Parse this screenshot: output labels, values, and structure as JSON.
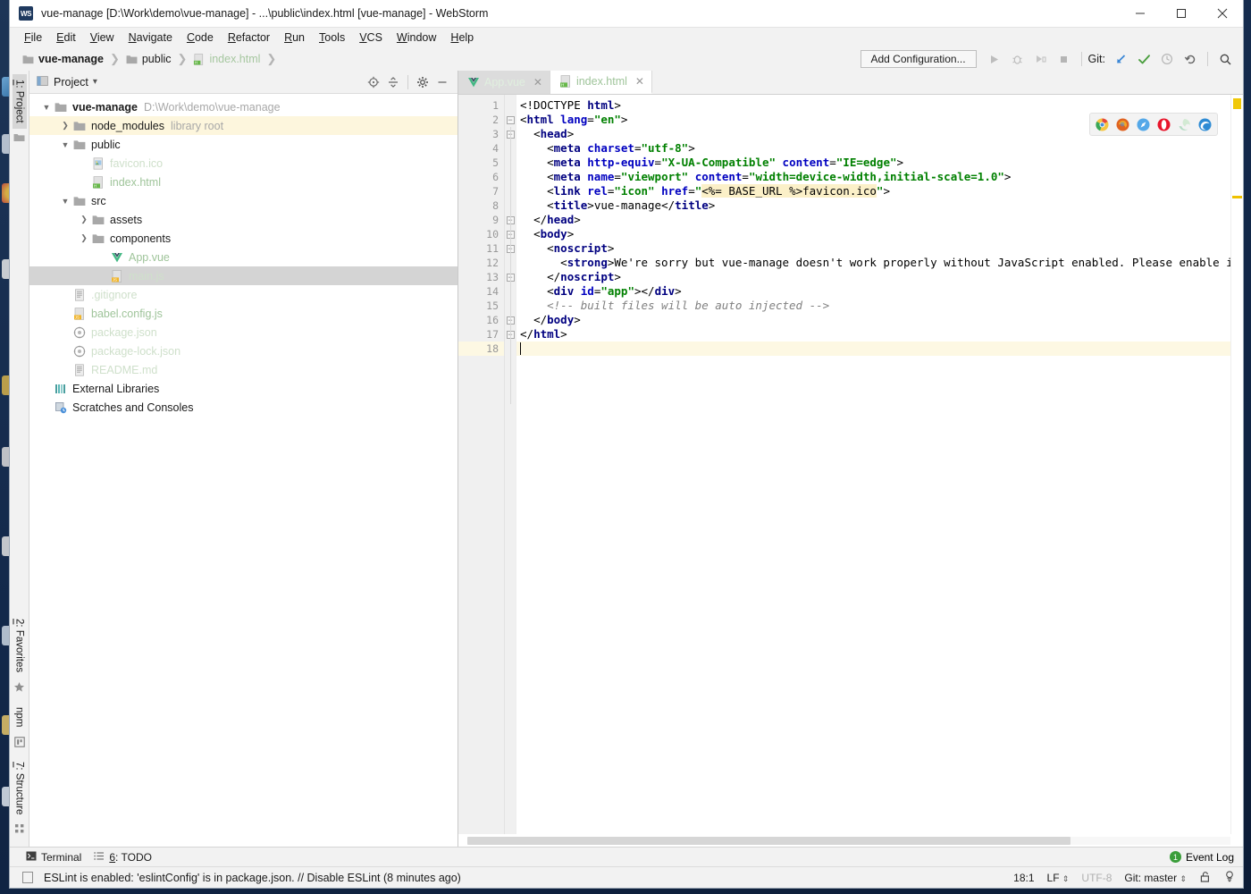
{
  "window": {
    "title": "vue-manage [D:\\Work\\demo\\vue-manage] - ...\\public\\index.html [vue-manage] - WebStorm",
    "logo_text": "WS",
    "minimize": "—",
    "maximize": "▢",
    "close": "✕"
  },
  "menu": [
    "File",
    "Edit",
    "View",
    "Navigate",
    "Code",
    "Refactor",
    "Run",
    "Tools",
    "VCS",
    "Window",
    "Help"
  ],
  "breadcrumb": [
    {
      "label": "vue-manage",
      "style": "bold",
      "icon": "folder-icon"
    },
    {
      "label": "public",
      "style": "normal",
      "icon": "folder-icon"
    },
    {
      "label": "index.html",
      "style": "green",
      "icon": "html-file-icon"
    }
  ],
  "toolbar": {
    "add_configuration": "Add Configuration...",
    "run_icon": "run-icon",
    "debug_icon": "debug-icon",
    "coverage_icon": "coverage-icon",
    "stop_icon": "stop-icon",
    "git_label": "Git:",
    "update_icon": "vcs-update-icon",
    "commit_icon": "vcs-commit-icon",
    "history_icon": "vcs-history-icon",
    "rollback_icon": "vcs-rollback-icon",
    "search_icon": "search-everywhere-icon"
  },
  "left_strip": {
    "top": [
      {
        "label": "1: Project",
        "active": true
      }
    ],
    "bottom": [
      {
        "label": "2: Favorites"
      },
      {
        "label": "npm"
      },
      {
        "label": "7: Structure"
      }
    ]
  },
  "project_panel": {
    "title": "Project",
    "dropdown": "▾",
    "tools": [
      "locate-icon",
      "collapse-all-icon",
      "settings-gear-icon",
      "hide-panel-icon"
    ],
    "tree": [
      {
        "indent": 0,
        "arrow": "down",
        "icon": "folder-icon",
        "label": "vue-manage",
        "style": "bold",
        "sub": "D:\\Work\\demo\\vue-manage",
        "state": "normal"
      },
      {
        "indent": 1,
        "arrow": "right",
        "icon": "folder-icon",
        "label": "node_modules",
        "style": "normal",
        "sub": "library root",
        "state": "highlight"
      },
      {
        "indent": 1,
        "arrow": "down",
        "icon": "folder-icon",
        "label": "public",
        "style": "normal",
        "sub": "",
        "state": "normal"
      },
      {
        "indent": 2,
        "arrow": "none",
        "icon": "image-file-icon",
        "label": "favicon.ico",
        "style": "faint",
        "sub": "",
        "state": "normal"
      },
      {
        "indent": 2,
        "arrow": "none",
        "icon": "html-file-icon",
        "label": "index.html",
        "style": "green",
        "sub": "",
        "state": "normal"
      },
      {
        "indent": 1,
        "arrow": "down",
        "icon": "folder-icon",
        "label": "src",
        "style": "normal",
        "sub": "",
        "state": "normal"
      },
      {
        "indent": 2,
        "arrow": "right",
        "icon": "folder-icon",
        "label": "assets",
        "style": "normal",
        "sub": "",
        "state": "normal"
      },
      {
        "indent": 2,
        "arrow": "right",
        "icon": "folder-icon",
        "label": "components",
        "style": "normal",
        "sub": "",
        "state": "normal"
      },
      {
        "indent": 3,
        "arrow": "none",
        "icon": "vue-file-icon",
        "label": "App.vue",
        "style": "green",
        "sub": "",
        "state": "normal"
      },
      {
        "indent": 3,
        "arrow": "none",
        "icon": "js-file-icon",
        "label": "main.js",
        "style": "faint",
        "sub": "",
        "state": "selected"
      },
      {
        "indent": 1,
        "arrow": "none",
        "icon": "text-file-icon",
        "label": ".gitignore",
        "style": "faint",
        "sub": "",
        "state": "normal"
      },
      {
        "indent": 1,
        "arrow": "none",
        "icon": "js-file-icon",
        "label": "babel.config.js",
        "style": "green",
        "sub": "",
        "state": "normal"
      },
      {
        "indent": 1,
        "arrow": "none",
        "icon": "json-file-icon",
        "label": "package.json",
        "style": "faint",
        "sub": "",
        "state": "normal"
      },
      {
        "indent": 1,
        "arrow": "none",
        "icon": "json-file-icon",
        "label": "package-lock.json",
        "style": "faint",
        "sub": "",
        "state": "normal"
      },
      {
        "indent": 1,
        "arrow": "none",
        "icon": "text-file-icon",
        "label": "README.md",
        "style": "faint",
        "sub": "",
        "state": "normal"
      },
      {
        "indent": 0,
        "arrow": "none",
        "icon": "external-libraries-icon",
        "label": "External Libraries",
        "style": "normal",
        "sub": "",
        "state": "normal"
      },
      {
        "indent": 0,
        "arrow": "none",
        "icon": "scratches-icon",
        "label": "Scratches and Consoles",
        "style": "normal",
        "sub": "",
        "state": "normal"
      }
    ]
  },
  "editor": {
    "tabs": [
      {
        "label": "App.vue",
        "icon": "vue-file-icon",
        "active": false,
        "faded": true,
        "close": "✕"
      },
      {
        "label": "index.html",
        "icon": "html-file-icon",
        "active": true,
        "faded": false,
        "close": "✕"
      }
    ],
    "browsers": [
      "chrome-icon",
      "firefox-icon",
      "safari-icon",
      "opera-icon",
      "edge-legacy-icon",
      "edge-icon"
    ],
    "line_numbers": [
      1,
      2,
      3,
      4,
      5,
      6,
      7,
      8,
      9,
      10,
      11,
      12,
      13,
      14,
      15,
      16,
      17,
      18
    ],
    "caret_line": 18,
    "fold_lines": [
      2,
      3,
      9,
      10,
      11,
      13,
      16,
      17
    ],
    "lines": [
      {
        "n": 1,
        "tokens": [
          {
            "t": "punct",
            "v": "<!DOCTYPE "
          },
          {
            "t": "tag",
            "v": "html"
          },
          {
            "t": "punct",
            "v": ">"
          }
        ]
      },
      {
        "n": 2,
        "tokens": [
          {
            "t": "punct",
            "v": "<"
          },
          {
            "t": "tag",
            "v": "html"
          },
          {
            "t": "text",
            "v": " "
          },
          {
            "t": "attr",
            "v": "lang"
          },
          {
            "t": "punct",
            "v": "="
          },
          {
            "t": "val",
            "v": "\"en\""
          },
          {
            "t": "punct",
            "v": ">"
          }
        ]
      },
      {
        "n": 3,
        "tokens": [
          {
            "t": "text",
            "v": "  "
          },
          {
            "t": "punct",
            "v": "<"
          },
          {
            "t": "tag",
            "v": "head"
          },
          {
            "t": "punct",
            "v": ">"
          }
        ]
      },
      {
        "n": 4,
        "tokens": [
          {
            "t": "text",
            "v": "    "
          },
          {
            "t": "punct",
            "v": "<"
          },
          {
            "t": "tag",
            "v": "meta"
          },
          {
            "t": "text",
            "v": " "
          },
          {
            "t": "attr",
            "v": "charset"
          },
          {
            "t": "punct",
            "v": "="
          },
          {
            "t": "val",
            "v": "\"utf-8\""
          },
          {
            "t": "punct",
            "v": ">"
          }
        ]
      },
      {
        "n": 5,
        "tokens": [
          {
            "t": "text",
            "v": "    "
          },
          {
            "t": "punct",
            "v": "<"
          },
          {
            "t": "tag",
            "v": "meta"
          },
          {
            "t": "text",
            "v": " "
          },
          {
            "t": "attr",
            "v": "http-equiv"
          },
          {
            "t": "punct",
            "v": "="
          },
          {
            "t": "val",
            "v": "\"X-UA-Compatible\""
          },
          {
            "t": "text",
            "v": " "
          },
          {
            "t": "attr",
            "v": "content"
          },
          {
            "t": "punct",
            "v": "="
          },
          {
            "t": "val",
            "v": "\"IE=edge\""
          },
          {
            "t": "punct",
            "v": ">"
          }
        ]
      },
      {
        "n": 6,
        "tokens": [
          {
            "t": "text",
            "v": "    "
          },
          {
            "t": "punct",
            "v": "<"
          },
          {
            "t": "tag",
            "v": "meta"
          },
          {
            "t": "text",
            "v": " "
          },
          {
            "t": "attr",
            "v": "name"
          },
          {
            "t": "punct",
            "v": "="
          },
          {
            "t": "val",
            "v": "\"viewport\""
          },
          {
            "t": "text",
            "v": " "
          },
          {
            "t": "attr",
            "v": "content"
          },
          {
            "t": "punct",
            "v": "="
          },
          {
            "t": "val",
            "v": "\"width=device-width,initial-scale=1.0\""
          },
          {
            "t": "punct",
            "v": ">"
          }
        ]
      },
      {
        "n": 7,
        "tokens": [
          {
            "t": "text",
            "v": "    "
          },
          {
            "t": "punct",
            "v": "<"
          },
          {
            "t": "tag",
            "v": "link"
          },
          {
            "t": "text",
            "v": " "
          },
          {
            "t": "attr",
            "v": "rel"
          },
          {
            "t": "punct",
            "v": "="
          },
          {
            "t": "val",
            "v": "\"icon\""
          },
          {
            "t": "text",
            "v": " "
          },
          {
            "t": "attr",
            "v": "href"
          },
          {
            "t": "punct",
            "v": "="
          },
          {
            "t": "val",
            "v": "\""
          },
          {
            "t": "tpl",
            "v": "<%= BASE_URL %>favicon.ico"
          },
          {
            "t": "val",
            "v": "\""
          },
          {
            "t": "punct",
            "v": ">"
          }
        ]
      },
      {
        "n": 8,
        "tokens": [
          {
            "t": "text",
            "v": "    "
          },
          {
            "t": "punct",
            "v": "<"
          },
          {
            "t": "tag",
            "v": "title"
          },
          {
            "t": "punct",
            "v": ">"
          },
          {
            "t": "text",
            "v": "vue-manage"
          },
          {
            "t": "punct",
            "v": "</"
          },
          {
            "t": "tag",
            "v": "title"
          },
          {
            "t": "punct",
            "v": ">"
          }
        ]
      },
      {
        "n": 9,
        "tokens": [
          {
            "t": "text",
            "v": "  "
          },
          {
            "t": "punct",
            "v": "</"
          },
          {
            "t": "tag",
            "v": "head"
          },
          {
            "t": "punct",
            "v": ">"
          }
        ]
      },
      {
        "n": 10,
        "tokens": [
          {
            "t": "text",
            "v": "  "
          },
          {
            "t": "punct",
            "v": "<"
          },
          {
            "t": "tag",
            "v": "body"
          },
          {
            "t": "punct",
            "v": ">"
          }
        ]
      },
      {
        "n": 11,
        "tokens": [
          {
            "t": "text",
            "v": "    "
          },
          {
            "t": "punct",
            "v": "<"
          },
          {
            "t": "tag",
            "v": "noscript"
          },
          {
            "t": "punct",
            "v": ">"
          }
        ]
      },
      {
        "n": 12,
        "tokens": [
          {
            "t": "text",
            "v": "      "
          },
          {
            "t": "punct",
            "v": "<"
          },
          {
            "t": "tag",
            "v": "strong"
          },
          {
            "t": "punct",
            "v": ">"
          },
          {
            "t": "text",
            "v": "We're sorry but vue-manage doesn't work properly without JavaScript enabled. Please enable it to continu"
          }
        ]
      },
      {
        "n": 13,
        "tokens": [
          {
            "t": "text",
            "v": "    "
          },
          {
            "t": "punct",
            "v": "</"
          },
          {
            "t": "tag",
            "v": "noscript"
          },
          {
            "t": "punct",
            "v": ">"
          }
        ]
      },
      {
        "n": 14,
        "tokens": [
          {
            "t": "text",
            "v": "    "
          },
          {
            "t": "punct",
            "v": "<"
          },
          {
            "t": "tag",
            "v": "div"
          },
          {
            "t": "text",
            "v": " "
          },
          {
            "t": "attr",
            "v": "id"
          },
          {
            "t": "punct",
            "v": "="
          },
          {
            "t": "val",
            "v": "\"app\""
          },
          {
            "t": "punct",
            "v": "></"
          },
          {
            "t": "tag",
            "v": "div"
          },
          {
            "t": "punct",
            "v": ">"
          }
        ]
      },
      {
        "n": 15,
        "tokens": [
          {
            "t": "text",
            "v": "    "
          },
          {
            "t": "comment",
            "v": "<!-- built files will be auto injected -->"
          }
        ]
      },
      {
        "n": 16,
        "tokens": [
          {
            "t": "text",
            "v": "  "
          },
          {
            "t": "punct",
            "v": "</"
          },
          {
            "t": "tag",
            "v": "body"
          },
          {
            "t": "punct",
            "v": ">"
          }
        ]
      },
      {
        "n": 17,
        "tokens": [
          {
            "t": "punct",
            "v": "</"
          },
          {
            "t": "tag",
            "v": "html"
          },
          {
            "t": "punct",
            "v": ">"
          }
        ]
      },
      {
        "n": 18,
        "tokens": []
      }
    ]
  },
  "bottom_strip": {
    "terminal": "Terminal",
    "terminal_icon": "terminal-icon",
    "todo_num": "6",
    "todo": ": TODO",
    "todo_icon": "todo-list-icon",
    "event_log": "Event Log",
    "event_count": "1"
  },
  "status_bar": {
    "message": "ESLint is enabled: 'eslintConfig' is in package.json. // Disable ESLint (8 minutes ago)",
    "caret_position": "18:1",
    "line_separator": "LF",
    "encoding": "UTF-8",
    "branch": "Git: master",
    "lock_icon": "unlocked-icon",
    "inspection_icon": "inspection-icon",
    "spinner": "⇕"
  },
  "colors": {
    "accent_green": "#9fc49a",
    "tag_blue": "#000080",
    "attr_blue": "#0000c0",
    "value_green": "#008000",
    "comment_gray": "#808080",
    "highlight_yellow": "#fdf6dd",
    "warning_yellow": "#f0c808",
    "git_check_green": "#3a9e3a",
    "desktop_blue": "#13294b"
  }
}
